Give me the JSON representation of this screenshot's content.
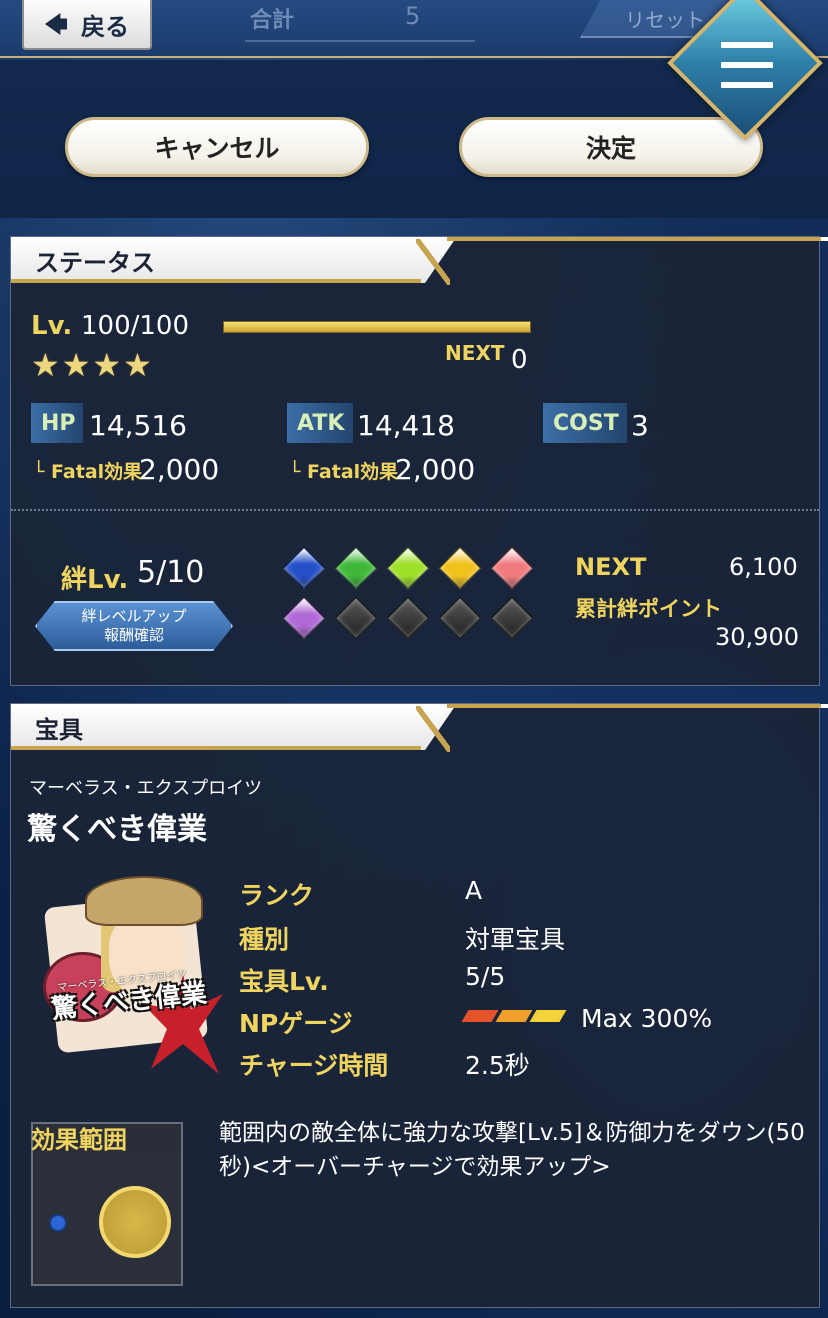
{
  "topbar": {
    "back_label": "戻る",
    "total_label": "合計",
    "total_value": "5",
    "reset_label": "リセット"
  },
  "actions": {
    "cancel_label": "キャンセル",
    "decide_label": "決定"
  },
  "status": {
    "title": "ステータス",
    "lv_label": "Lv.",
    "lv_value": "100/100",
    "lv_progress": 1.0,
    "stars": [
      "★",
      "★",
      "★",
      "★"
    ],
    "next_label": "NEXT",
    "next_value": "0",
    "hp_label": "HP",
    "hp_value": "14,516",
    "hp_fatal_label": "└ Fatal効果",
    "hp_fatal_value": "2,000",
    "atk_label": "ATK",
    "atk_value": "14,418",
    "atk_fatal_label": "└ Fatal効果",
    "atk_fatal_value": "2,000",
    "cost_label": "COST",
    "cost_value": "3",
    "bond_label": "絆Lv.",
    "bond_value": "5/10",
    "bond_button_line1": "絆レベルアップ",
    "bond_button_line2": "報酬確認",
    "bond_gems_row1": [
      "#2350c8",
      "#3fb83a",
      "#9ee02a",
      "#f0c21c",
      "#f07a80"
    ],
    "bond_gems_row2": [
      "#b06ad8",
      "#3a3a3a",
      "#3a3a3a",
      "#3a3a3a",
      "#3a3a3a"
    ],
    "bond_next_label": "NEXT",
    "bond_next_value": "6,100",
    "bond_points_label": "累計絆ポイント",
    "bond_points_value": "30,900"
  },
  "np": {
    "title": "宝具",
    "ruby": "マーベラス・エクスプロイツ",
    "name": "驚くべき偉業",
    "card_ruby": "マーベラス・エクスプロイツ",
    "card_title": "驚くべき偉業",
    "rank_label": "ランク",
    "rank_value": "A",
    "type_label": "種別",
    "type_value": "対軍宝具",
    "level_label": "宝具Lv.",
    "level_value": "5/5",
    "gauge_label": "NPゲージ",
    "gauge_value": "Max 300%",
    "gauge_colors": [
      "#e4532a",
      "#f0a02a",
      "#f3d23a"
    ],
    "charge_label": "チャージ時間",
    "charge_value": "2.5秒",
    "range_label": "効果範囲",
    "description": "範囲内の敵全体に強力な攻撃[Lv.5]＆防御力をダウン(50秒)<オーバーチャージで効果アップ>",
    "colors": {
      "accent_gold": "#f0d460",
      "panel_bg": "#1a2438"
    }
  }
}
